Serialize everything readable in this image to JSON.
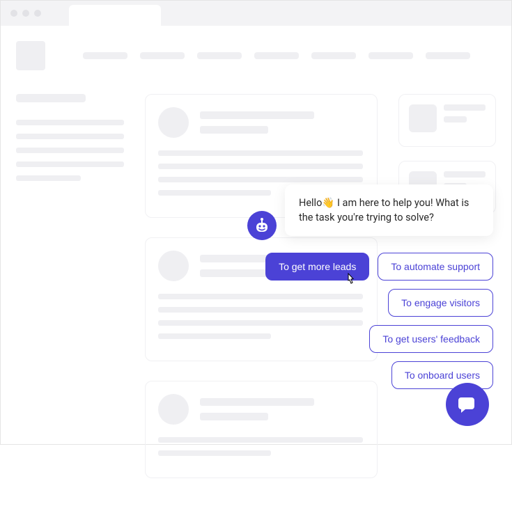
{
  "colors": {
    "primary": "#4b42d6",
    "skeleton": "#efeff2"
  },
  "bot": {
    "message_prefix": "Hello",
    "wave_emoji": "👋",
    "message_suffix": " I am here to help you! What is the task you're trying to solve?",
    "replies": [
      {
        "label": "To get more leads",
        "selected": true
      },
      {
        "label": "To automate support",
        "selected": false
      },
      {
        "label": "To engage visitors",
        "selected": false
      },
      {
        "label": "To get users' feedback",
        "selected": false
      },
      {
        "label": "To onboard users",
        "selected": false
      }
    ]
  }
}
